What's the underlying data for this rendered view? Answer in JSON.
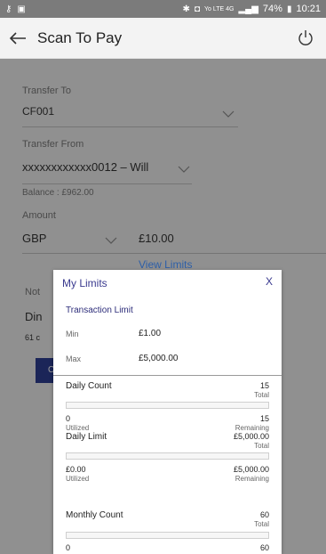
{
  "status_bar": {
    "battery": "74%",
    "time": "10:21",
    "network": "Yo LTE 4G"
  },
  "header": {
    "title": "Scan To Pay"
  },
  "form": {
    "transfer_to_label": "Transfer To",
    "transfer_to_value": "CF001",
    "transfer_from_label": "Transfer From",
    "transfer_from_value": "xxxxxxxxxxxx0012 – Will",
    "balance": "Balance : £962.00",
    "amount_label": "Amount",
    "currency": "GBP",
    "amount_value": "£10.00",
    "view_limits": "View Limits",
    "note_label_partial": "Not",
    "note_value_partial": "Din",
    "chars_partial": "61 c",
    "button_partial": "C"
  },
  "modal": {
    "title": "My Limits",
    "close": "X",
    "transaction_limit": {
      "title": "Transaction Limit",
      "min_label": "Min",
      "min_value": "£1.00",
      "max_label": "Max",
      "max_value": "£5,000.00"
    },
    "daily_count": {
      "title": "Daily Count",
      "total": "15",
      "total_label": "Total",
      "utilized": "0",
      "utilized_label": "Utilized",
      "remaining": "15",
      "remaining_label": "Remaining",
      "fill_fraction": 0
    },
    "daily_limit": {
      "title": "Daily Limit",
      "total": "£5,000.00",
      "total_label": "Total",
      "utilized": "£0.00",
      "utilized_label": "Utilized",
      "remaining": "£5,000.00",
      "remaining_label": "Remaining",
      "fill_fraction": 0
    },
    "monthly_count": {
      "title": "Monthly Count",
      "total": "60",
      "total_label": "Total",
      "utilized": "0",
      "remaining": "60",
      "fill_fraction": 0
    }
  },
  "colors": {
    "accent": "#2d5fa8",
    "modal_title": "#3a3a8f"
  }
}
